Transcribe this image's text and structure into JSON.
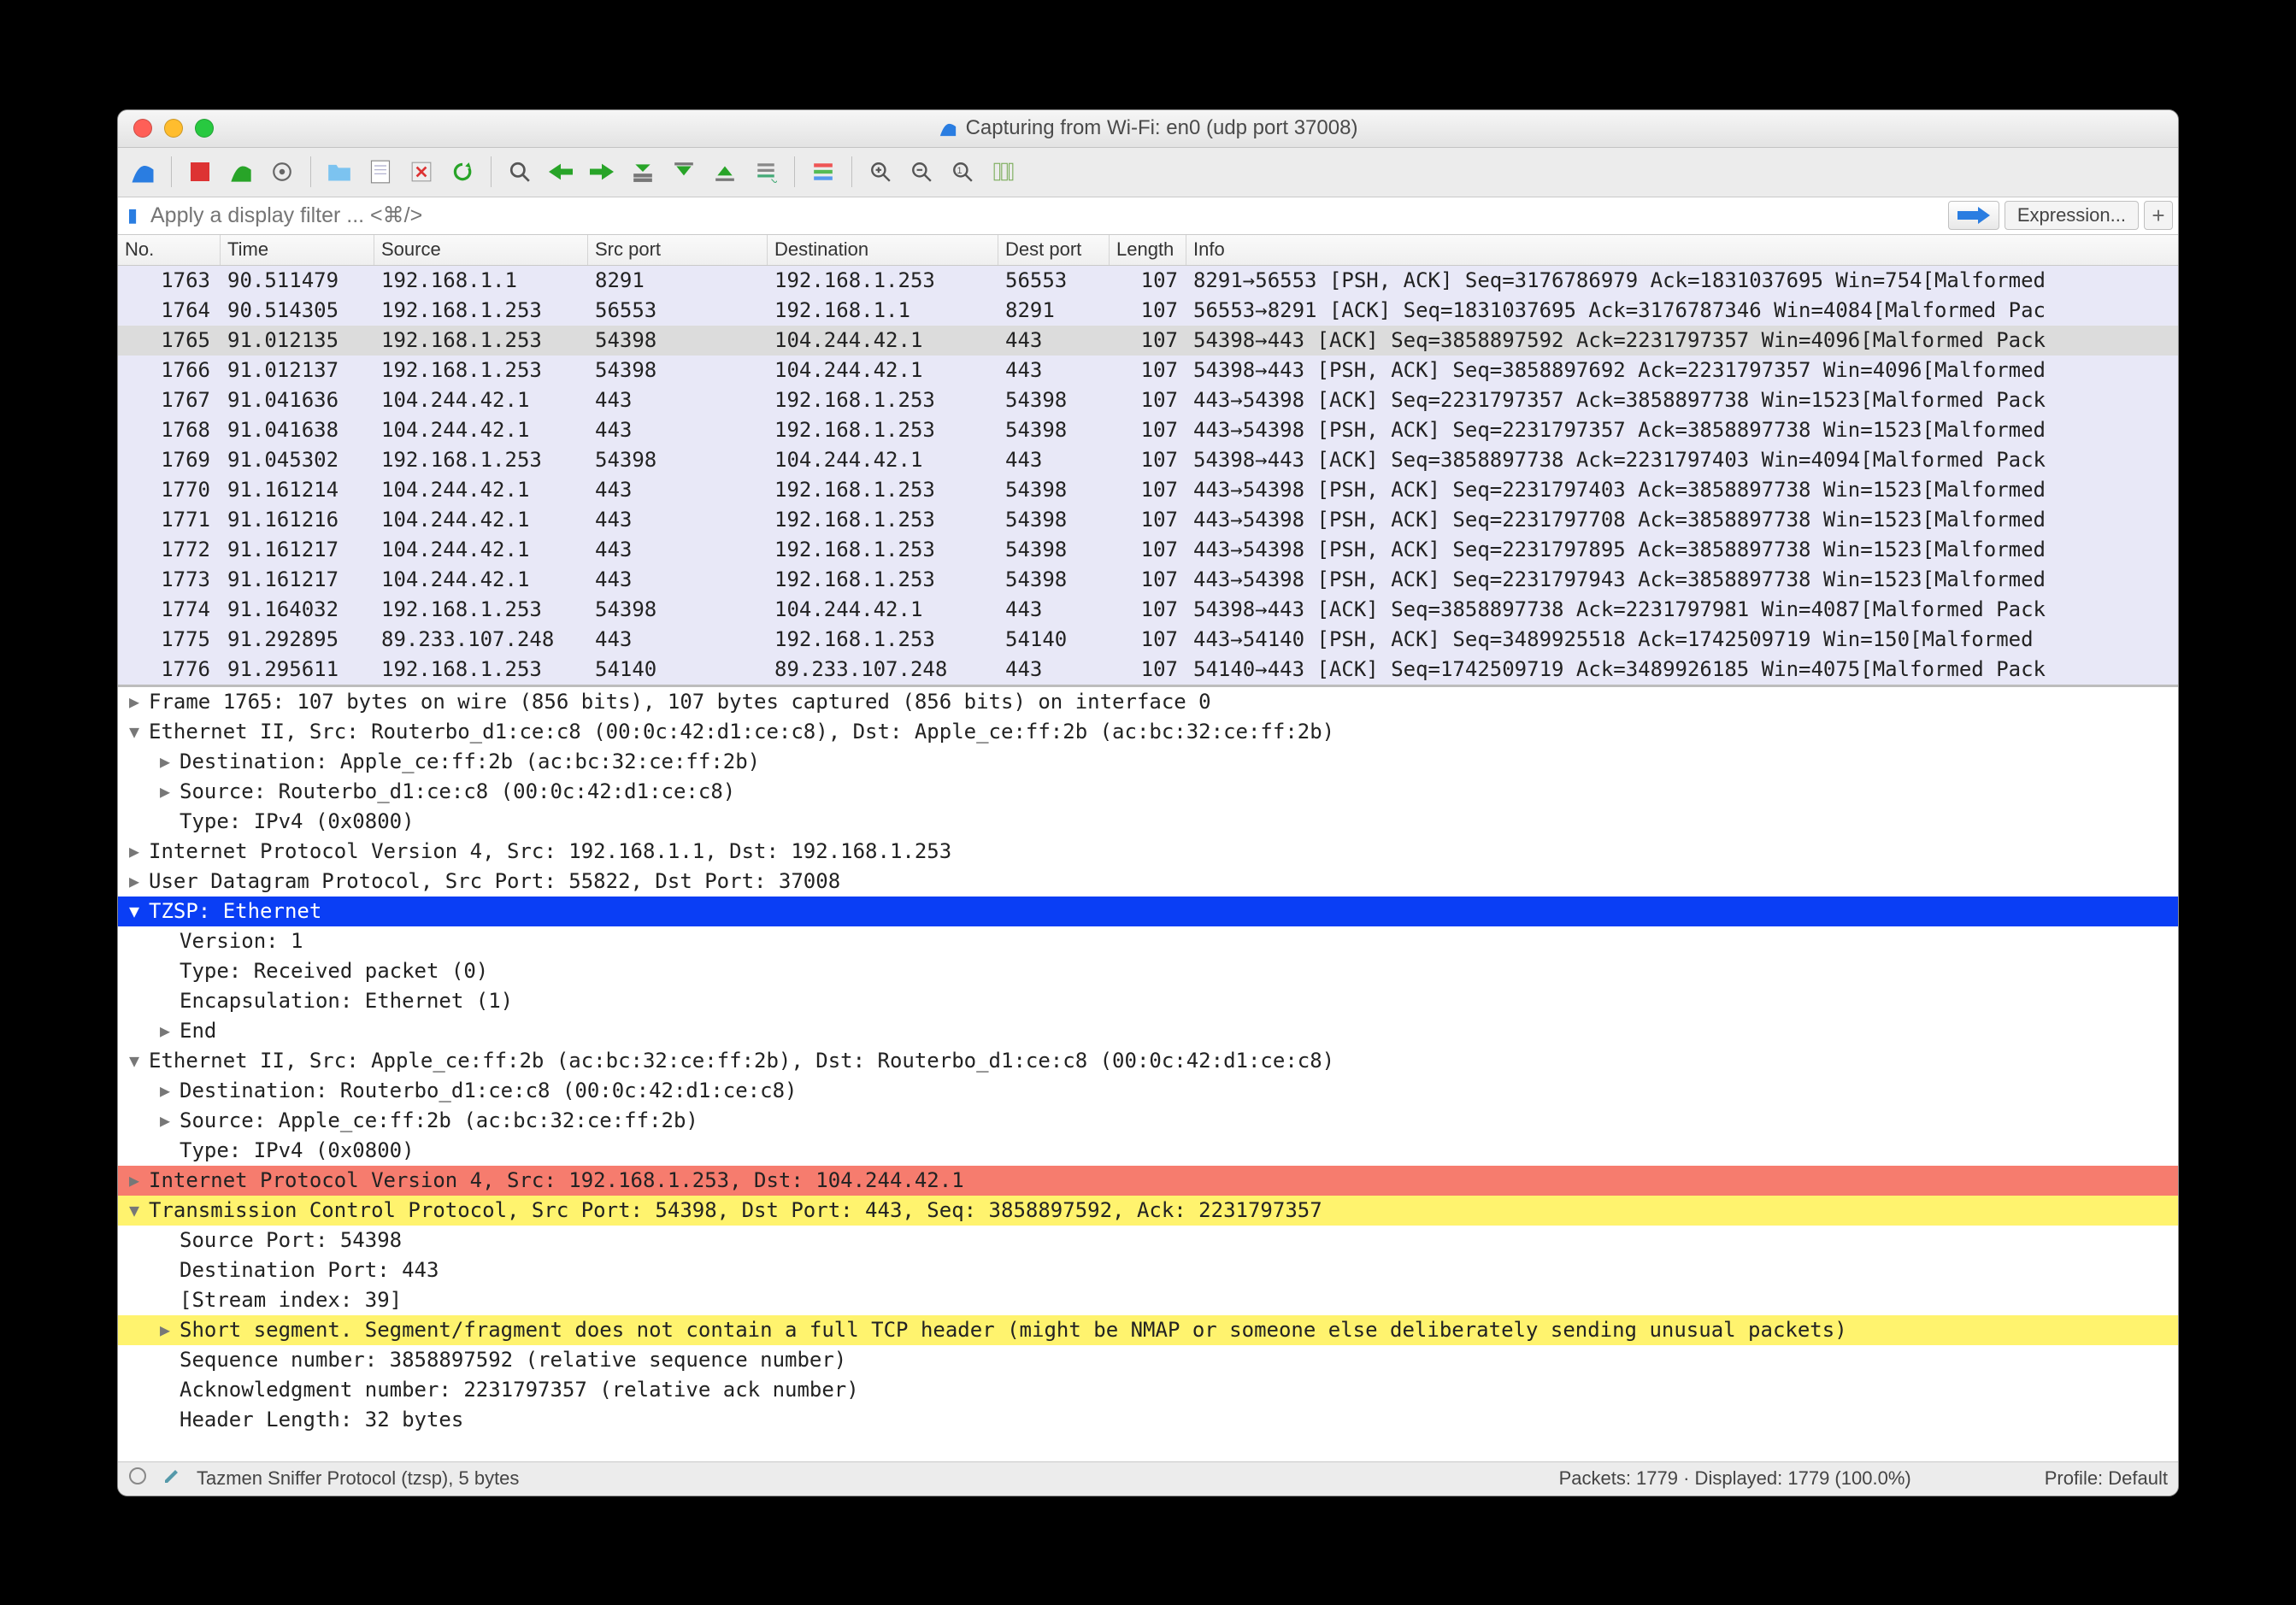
{
  "title": "Capturing from Wi-Fi: en0 (udp port 37008)",
  "filter_placeholder": "Apply a display filter ... <⌘/>",
  "expression_label": "Expression...",
  "columns": {
    "no": "No.",
    "time": "Time",
    "src": "Source",
    "sprt": "Src port",
    "dst": "Destination",
    "dprt": "Dest port",
    "len": "Length",
    "info": "Info"
  },
  "packets": [
    {
      "no": "1763",
      "time": "90.511479",
      "src": "192.168.1.1",
      "sprt": "8291",
      "dst": "192.168.1.253",
      "dprt": "56553",
      "len": "107",
      "info": "8291→56553 [PSH, ACK] Seq=3176786979 Ack=1831037695 Win=754[Malformed",
      "bg": "lav"
    },
    {
      "no": "1764",
      "time": "90.514305",
      "src": "192.168.1.253",
      "sprt": "56553",
      "dst": "192.168.1.1",
      "dprt": "8291",
      "len": "107",
      "info": "56553→8291 [ACK] Seq=1831037695 Ack=3176787346 Win=4084[Malformed Pac",
      "bg": "lav"
    },
    {
      "no": "1765",
      "time": "91.012135",
      "src": "192.168.1.253",
      "sprt": "54398",
      "dst": "104.244.42.1",
      "dprt": "443",
      "len": "107",
      "info": "54398→443 [ACK] Seq=3858897592 Ack=2231797357 Win=4096[Malformed Pack",
      "bg": "sel"
    },
    {
      "no": "1766",
      "time": "91.012137",
      "src": "192.168.1.253",
      "sprt": "54398",
      "dst": "104.244.42.1",
      "dprt": "443",
      "len": "107",
      "info": "54398→443 [PSH, ACK] Seq=3858897692 Ack=2231797357 Win=4096[Malformed",
      "bg": "lav"
    },
    {
      "no": "1767",
      "time": "91.041636",
      "src": "104.244.42.1",
      "sprt": "443",
      "dst": "192.168.1.253",
      "dprt": "54398",
      "len": "107",
      "info": "443→54398 [ACK] Seq=2231797357 Ack=3858897738 Win=1523[Malformed Pack",
      "bg": "lav"
    },
    {
      "no": "1768",
      "time": "91.041638",
      "src": "104.244.42.1",
      "sprt": "443",
      "dst": "192.168.1.253",
      "dprt": "54398",
      "len": "107",
      "info": "443→54398 [PSH, ACK] Seq=2231797357 Ack=3858897738 Win=1523[Malformed",
      "bg": "lav"
    },
    {
      "no": "1769",
      "time": "91.045302",
      "src": "192.168.1.253",
      "sprt": "54398",
      "dst": "104.244.42.1",
      "dprt": "443",
      "len": "107",
      "info": "54398→443 [ACK] Seq=3858897738 Ack=2231797403 Win=4094[Malformed Pack",
      "bg": "lav"
    },
    {
      "no": "1770",
      "time": "91.161214",
      "src": "104.244.42.1",
      "sprt": "443",
      "dst": "192.168.1.253",
      "dprt": "54398",
      "len": "107",
      "info": "443→54398 [PSH, ACK] Seq=2231797403 Ack=3858897738 Win=1523[Malformed",
      "bg": "lav"
    },
    {
      "no": "1771",
      "time": "91.161216",
      "src": "104.244.42.1",
      "sprt": "443",
      "dst": "192.168.1.253",
      "dprt": "54398",
      "len": "107",
      "info": "443→54398 [PSH, ACK] Seq=2231797708 Ack=3858897738 Win=1523[Malformed",
      "bg": "lav"
    },
    {
      "no": "1772",
      "time": "91.161217",
      "src": "104.244.42.1",
      "sprt": "443",
      "dst": "192.168.1.253",
      "dprt": "54398",
      "len": "107",
      "info": "443→54398 [PSH, ACK] Seq=2231797895 Ack=3858897738 Win=1523[Malformed",
      "bg": "lav"
    },
    {
      "no": "1773",
      "time": "91.161217",
      "src": "104.244.42.1",
      "sprt": "443",
      "dst": "192.168.1.253",
      "dprt": "54398",
      "len": "107",
      "info": "443→54398 [PSH, ACK] Seq=2231797943 Ack=3858897738 Win=1523[Malformed",
      "bg": "lav"
    },
    {
      "no": "1774",
      "time": "91.164032",
      "src": "192.168.1.253",
      "sprt": "54398",
      "dst": "104.244.42.1",
      "dprt": "443",
      "len": "107",
      "info": "54398→443 [ACK] Seq=3858897738 Ack=2231797981 Win=4087[Malformed Pack",
      "bg": "lav"
    },
    {
      "no": "1775",
      "time": "91.292895",
      "src": "89.233.107.248",
      "sprt": "443",
      "dst": "192.168.1.253",
      "dprt": "54140",
      "len": "107",
      "info": "443→54140 [PSH, ACK] Seq=3489925518 Ack=1742509719 Win=150[Malformed",
      "bg": "lav"
    },
    {
      "no": "1776",
      "time": "91.295611",
      "src": "192.168.1.253",
      "sprt": "54140",
      "dst": "89.233.107.248",
      "dprt": "443",
      "len": "107",
      "info": "54140→443 [ACK] Seq=1742509719 Ack=3489926185 Win=4075[Malformed Pack",
      "bg": "lav"
    }
  ],
  "details": [
    {
      "tri": "▶",
      "ind": 0,
      "bg": "",
      "txt": "Frame 1765: 107 bytes on wire (856 bits), 107 bytes captured (856 bits) on interface 0"
    },
    {
      "tri": "▼",
      "ind": 0,
      "bg": "",
      "txt": "Ethernet II, Src: Routerbo_d1:ce:c8 (00:0c:42:d1:ce:c8), Dst: Apple_ce:ff:2b (ac:bc:32:ce:ff:2b)"
    },
    {
      "tri": "▶",
      "ind": 1,
      "bg": "",
      "txt": "Destination: Apple_ce:ff:2b (ac:bc:32:ce:ff:2b)"
    },
    {
      "tri": "▶",
      "ind": 1,
      "bg": "",
      "txt": "Source: Routerbo_d1:ce:c8 (00:0c:42:d1:ce:c8)"
    },
    {
      "tri": "",
      "ind": 1,
      "bg": "",
      "txt": "Type: IPv4 (0x0800)"
    },
    {
      "tri": "▶",
      "ind": 0,
      "bg": "",
      "txt": "Internet Protocol Version 4, Src: 192.168.1.1, Dst: 192.168.1.253"
    },
    {
      "tri": "▶",
      "ind": 0,
      "bg": "",
      "txt": "User Datagram Protocol, Src Port: 55822, Dst Port: 37008"
    },
    {
      "tri": "▼",
      "ind": 0,
      "bg": "blue",
      "txt": "TZSP: Ethernet"
    },
    {
      "tri": "",
      "ind": 1,
      "bg": "",
      "txt": "Version: 1"
    },
    {
      "tri": "",
      "ind": 1,
      "bg": "",
      "txt": "Type: Received packet (0)"
    },
    {
      "tri": "",
      "ind": 1,
      "bg": "",
      "txt": "Encapsulation: Ethernet (1)"
    },
    {
      "tri": "▶",
      "ind": 1,
      "bg": "",
      "txt": "End"
    },
    {
      "tri": "▼",
      "ind": 0,
      "bg": "",
      "txt": "Ethernet II, Src: Apple_ce:ff:2b (ac:bc:32:ce:ff:2b), Dst: Routerbo_d1:ce:c8 (00:0c:42:d1:ce:c8)"
    },
    {
      "tri": "▶",
      "ind": 1,
      "bg": "",
      "txt": "Destination: Routerbo_d1:ce:c8 (00:0c:42:d1:ce:c8)"
    },
    {
      "tri": "▶",
      "ind": 1,
      "bg": "",
      "txt": "Source: Apple_ce:ff:2b (ac:bc:32:ce:ff:2b)"
    },
    {
      "tri": "",
      "ind": 1,
      "bg": "",
      "txt": "Type: IPv4 (0x0800)"
    },
    {
      "tri": "▶",
      "ind": 0,
      "bg": "red",
      "txt": "Internet Protocol Version 4, Src: 192.168.1.253, Dst: 104.244.42.1"
    },
    {
      "tri": "▼",
      "ind": 0,
      "bg": "yel",
      "txt": "Transmission Control Protocol, Src Port: 54398, Dst Port: 443, Seq: 3858897592, Ack: 2231797357"
    },
    {
      "tri": "",
      "ind": 1,
      "bg": "",
      "txt": "Source Port: 54398"
    },
    {
      "tri": "",
      "ind": 1,
      "bg": "",
      "txt": "Destination Port: 443"
    },
    {
      "tri": "",
      "ind": 1,
      "bg": "",
      "txt": "[Stream index: 39]"
    },
    {
      "tri": "▶",
      "ind": 1,
      "bg": "yel",
      "txt": "Short segment. Segment/fragment does not contain a full TCP header (might be NMAP or someone else deliberately sending unusual packets)"
    },
    {
      "tri": "",
      "ind": 1,
      "bg": "",
      "txt": "Sequence number: 3858897592    (relative sequence number)"
    },
    {
      "tri": "",
      "ind": 1,
      "bg": "",
      "txt": "Acknowledgment number: 2231797357    (relative ack number)"
    },
    {
      "tri": "",
      "ind": 1,
      "bg": "",
      "txt": "Header Length: 32 bytes"
    }
  ],
  "status": {
    "proto": "Tazmen Sniffer Protocol (tzsp), 5 bytes",
    "counts": "Packets: 1779 · Displayed: 1779 (100.0%)",
    "profile": "Profile: Default"
  }
}
